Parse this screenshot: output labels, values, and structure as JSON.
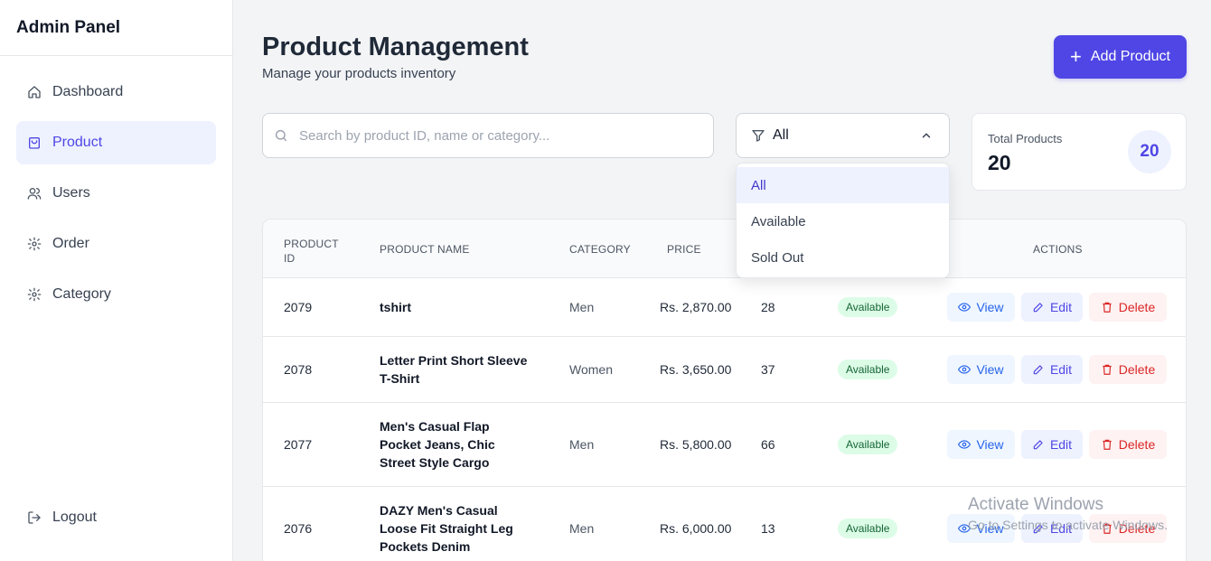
{
  "sidebar": {
    "brand": "Admin Panel",
    "items": [
      {
        "label": "Dashboard",
        "icon": "home-icon"
      },
      {
        "label": "Product",
        "icon": "shopping-bag-icon"
      },
      {
        "label": "Users",
        "icon": "users-icon"
      },
      {
        "label": "Order",
        "icon": "gear-icon"
      },
      {
        "label": "Category",
        "icon": "gear-icon"
      }
    ],
    "logout_label": "Logout"
  },
  "header": {
    "title": "Product Management",
    "subtitle": "Manage your products inventory",
    "add_button_label": "Add Product"
  },
  "search": {
    "placeholder": "Search by product ID, name or category..."
  },
  "filter": {
    "selected": "All",
    "options": [
      "All",
      "Available",
      "Sold Out"
    ]
  },
  "stats": {
    "total_label": "Total Products",
    "total_value": "20",
    "total_badge": "20"
  },
  "table": {
    "headers": {
      "id": "PRODUCT ID",
      "name": "PRODUCT NAME",
      "category": "CATEGORY",
      "price": "PRICE",
      "actions": "ACTIONS"
    },
    "rows": [
      {
        "id": "2079",
        "name": "tshirt",
        "category": "Men",
        "price": "Rs. 2,870.00",
        "stock": "28",
        "status": "Available"
      },
      {
        "id": "2078",
        "name": "Letter Print Short Sleeve T-Shirt",
        "category": "Women",
        "price": "Rs. 3,650.00",
        "stock": "37",
        "status": "Available"
      },
      {
        "id": "2077",
        "name": "Men's Casual Flap Pocket Jeans, Chic Street Style Cargo",
        "category": "Men",
        "price": "Rs. 5,800.00",
        "stock": "66",
        "status": "Available"
      },
      {
        "id": "2076",
        "name": "DAZY Men's Casual Loose Fit Straight Leg Pockets Denim",
        "category": "Men",
        "price": "Rs. 6,000.00",
        "stock": "13",
        "status": "Available"
      }
    ],
    "actions": {
      "view": "View",
      "edit": "Edit",
      "delete": "Delete"
    }
  },
  "watermark": {
    "title": "Activate Windows",
    "subtitle": "Go to Settings to activate Windows."
  },
  "colors": {
    "accent": "#4f46e5",
    "available_bg": "#dcfce7",
    "available_text": "#166534",
    "delete": "#dc2626",
    "view": "#2563eb"
  }
}
